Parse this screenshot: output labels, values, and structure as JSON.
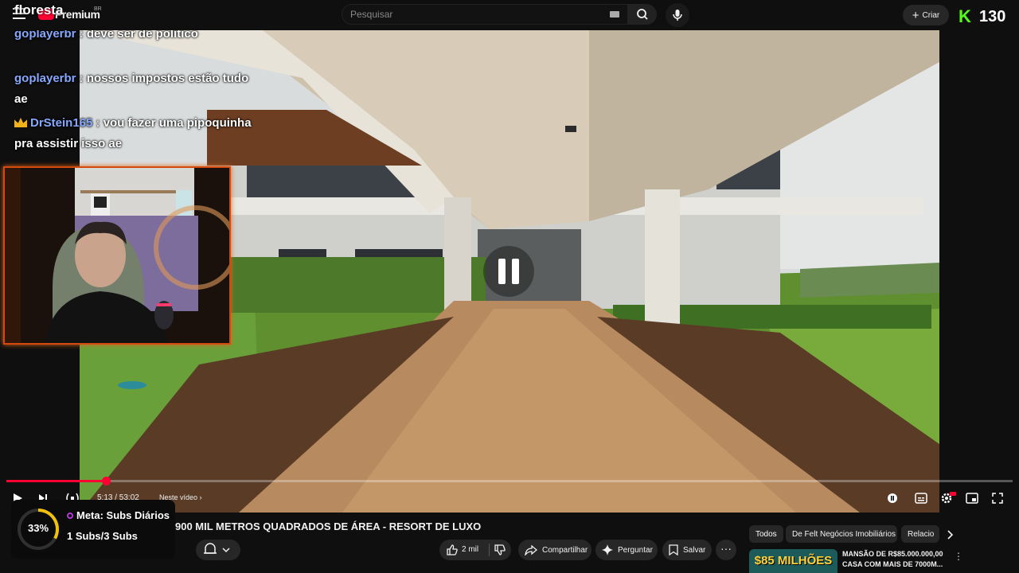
{
  "header": {
    "channel_overlay": "floresta",
    "logo_text": "Premium",
    "logo_region": "BR",
    "search_placeholder": "Pesquisar",
    "create_label": "Criar",
    "kick_logo": "K",
    "kick_count": "130"
  },
  "chat": [
    {
      "user": "goplayerbr",
      "badge": null,
      "message": "deve ser de politico"
    },
    {
      "user": "goplayerbr",
      "badge": null,
      "message": "nossos impostos estão tudo ae"
    },
    {
      "user": "DrStein165",
      "badge": "crown-icon",
      "message": "vou fazer uma pipoquinha pra assistir isso ae"
    }
  ],
  "player": {
    "state": "paused",
    "progress": 0.0989,
    "time_current": "5:13",
    "time_total": "53:02",
    "time_display": "5:13 / 53:02",
    "chapter_label": "Neste vídeo"
  },
  "video": {
    "title": "900 MIL METROS QUADRADOS DE ÁREA - RESORT DE LUXO",
    "likes": "2 mil",
    "actions": {
      "share": "Compartilhar",
      "ask": "Perguntar",
      "save": "Salvar"
    }
  },
  "goal_widget": {
    "percent_label": "33%",
    "percent": 33,
    "title": "Meta: Subs Diários",
    "progress_text": "1 Subs/3 Subs"
  },
  "chips": [
    "Todos",
    "De Felt Negócios Imobiliários",
    "Relacio"
  ],
  "recommendation": {
    "thumb_label": "$85 MILHÕES",
    "title": "MANSÃO DE R$85.000.000,00 CASA COM MAIS DE 7000M..."
  },
  "colors": {
    "background": "#0f0f0f",
    "accent_red": "#ff0033",
    "kick_green": "#53fc18",
    "chat_username": "#86a9ff",
    "goal_ring": "#f2c00e",
    "webcam_border": "#d34a10"
  }
}
